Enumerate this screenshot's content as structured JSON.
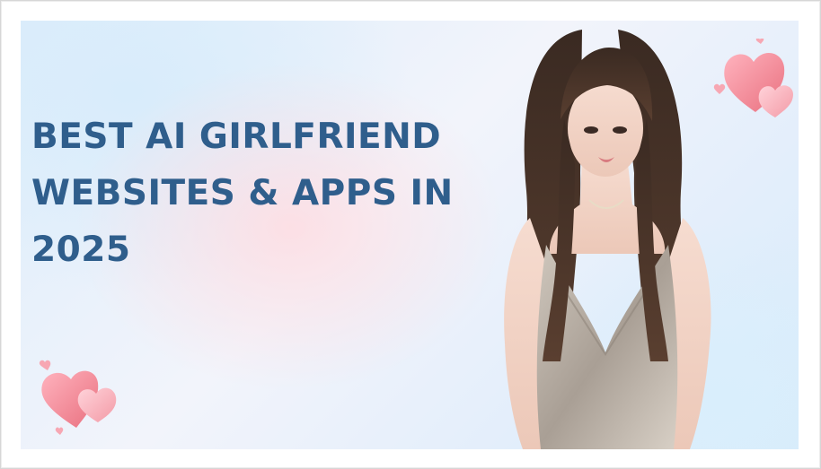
{
  "banner": {
    "headline_lines": [
      "BEST AI GIRLFRIEND",
      "WEBSITES & APPS IN",
      "2025"
    ]
  },
  "colors": {
    "headline": "#2f5e8c",
    "heart_primary": "#f08a9a",
    "heart_light": "#f7b3bd",
    "background_blue": "#dcedfb",
    "background_pink": "#ffdce1"
  },
  "decorations": {
    "top_right": "hearts-icon",
    "bottom_left": "hearts-icon"
  }
}
